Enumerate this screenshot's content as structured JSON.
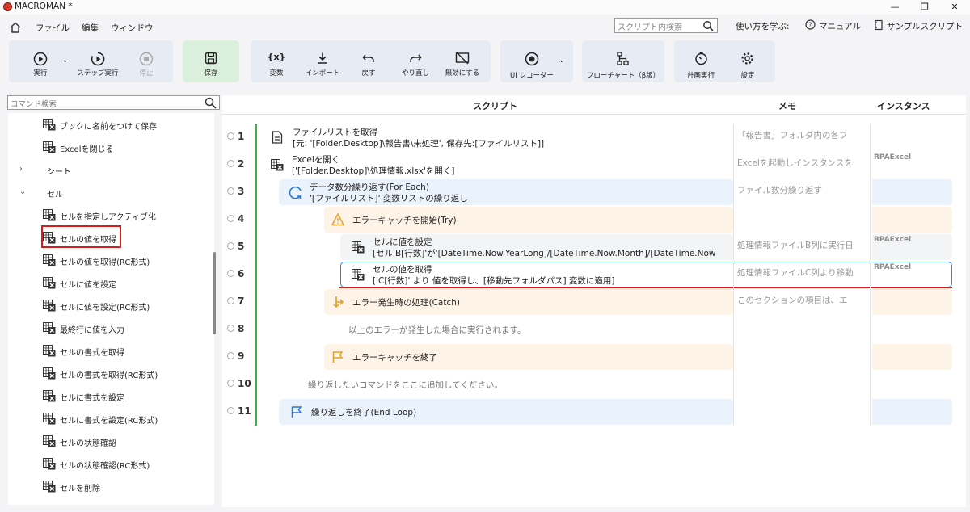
{
  "window": {
    "title": "MACROMAN *",
    "min": "—",
    "restore": "❐",
    "close": "✕"
  },
  "menu": {
    "file": "ファイル",
    "edit": "編集",
    "window": "ウィンドウ"
  },
  "search": {
    "placeholder": "スクリプト内検索"
  },
  "links": {
    "learn": "使い方を学ぶ:",
    "manual": "マニュアル",
    "samples": "サンプルスクリプト"
  },
  "toolbar": {
    "run": "実行",
    "step": "ステップ実行",
    "stop": "停止",
    "save": "保存",
    "var": "変数",
    "import": "インポート",
    "undo": "戻す",
    "redo": "やり直し",
    "disable": "無効にする",
    "recorder": "UI レコーダー",
    "flowchart": "フローチャート（β版）",
    "schedule": "計画実行",
    "settings": "設定"
  },
  "left": {
    "search_placeholder": "コマンド検索",
    "items": [
      {
        "label": "ブックに名前をつけて保存",
        "type": "cmd"
      },
      {
        "label": "Excelを閉じる",
        "type": "cmd"
      },
      {
        "label": "シート",
        "type": "cat",
        "chevron": "›"
      },
      {
        "label": "セル",
        "type": "cat",
        "chevron": "⌄"
      },
      {
        "label": "セルを指定しアクティブ化",
        "type": "cmd"
      },
      {
        "label": "セルの値を取得",
        "type": "cmd"
      },
      {
        "label": "セルの値を取得(RC形式)",
        "type": "cmd"
      },
      {
        "label": "セルに値を設定",
        "type": "cmd"
      },
      {
        "label": "セルに値を設定(RC形式)",
        "type": "cmd"
      },
      {
        "label": "最終行に値を入力",
        "type": "cmd"
      },
      {
        "label": "セルの書式を取得",
        "type": "cmd"
      },
      {
        "label": "セルの書式を取得(RC形式)",
        "type": "cmd"
      },
      {
        "label": "セルに書式を設定",
        "type": "cmd"
      },
      {
        "label": "セルに書式を設定(RC形式)",
        "type": "cmd"
      },
      {
        "label": "セルの状態確認",
        "type": "cmd"
      },
      {
        "label": "セルの状態確認(RC形式)",
        "type": "cmd"
      },
      {
        "label": "セルを削除",
        "type": "cmd"
      }
    ]
  },
  "columns": {
    "script": "スクリプト",
    "memo": "メモ",
    "instance": "インスタンス"
  },
  "rows": [
    {
      "num": "1",
      "t1": "ファイルリストを取得",
      "t2": "[元: '[Folder.Desktop]\\報告書\\未処理', 保存先:[ファイルリスト]]",
      "memo": "「報告書」フォルダ内の各フ",
      "inst": ""
    },
    {
      "num": "2",
      "t1": "Excelを開く",
      "t2": "['[Folder.Desktop]\\処理情報.xlsx'を開く]",
      "memo": "Excelを起動しインスタンスを",
      "inst": "RPAExcel"
    },
    {
      "num": "3",
      "t1": "データ数分繰り返す(For Each)",
      "t2": "'[ファイルリスト]' 変数リストの繰り返し",
      "memo": "ファイル数分繰り返す",
      "inst": ""
    },
    {
      "num": "4",
      "t1": "エラーキャッチを開始(Try)",
      "t2": "",
      "memo": "",
      "inst": ""
    },
    {
      "num": "5",
      "t1": "セルに値を設定",
      "t2": "[セル'B[行数]'が'[DateTime.Now.YearLong]/[DateTime.Now.Month]/[DateTime.Now",
      "memo": "処理情報ファイルB列に実行日",
      "inst": "RPAExcel"
    },
    {
      "num": "6",
      "t1": "セルの値を取得",
      "t2": "['C[行数]' より 値を取得し、[移動先フォルダパス] 変数に適用]",
      "memo": "処理情報ファイルC列より移動",
      "inst": "RPAExcel"
    },
    {
      "num": "7",
      "t1": "エラー発生時の処理(Catch)",
      "t2": "",
      "memo": "このセクションの項目は、エ",
      "inst": ""
    },
    {
      "num": "8",
      "t1": "以上のエラーが発生した場合に実行されます。",
      "t2": "",
      "memo": "",
      "inst": ""
    },
    {
      "num": "9",
      "t1": "エラーキャッチを終了",
      "t2": "",
      "memo": "",
      "inst": ""
    },
    {
      "num": "10",
      "t1": "繰り返したいコマンドをここに追加してください。",
      "t2": "",
      "memo": "",
      "inst": ""
    },
    {
      "num": "11",
      "t1": "繰り返しを終了(End Loop)",
      "t2": "",
      "memo": "",
      "inst": ""
    }
  ]
}
